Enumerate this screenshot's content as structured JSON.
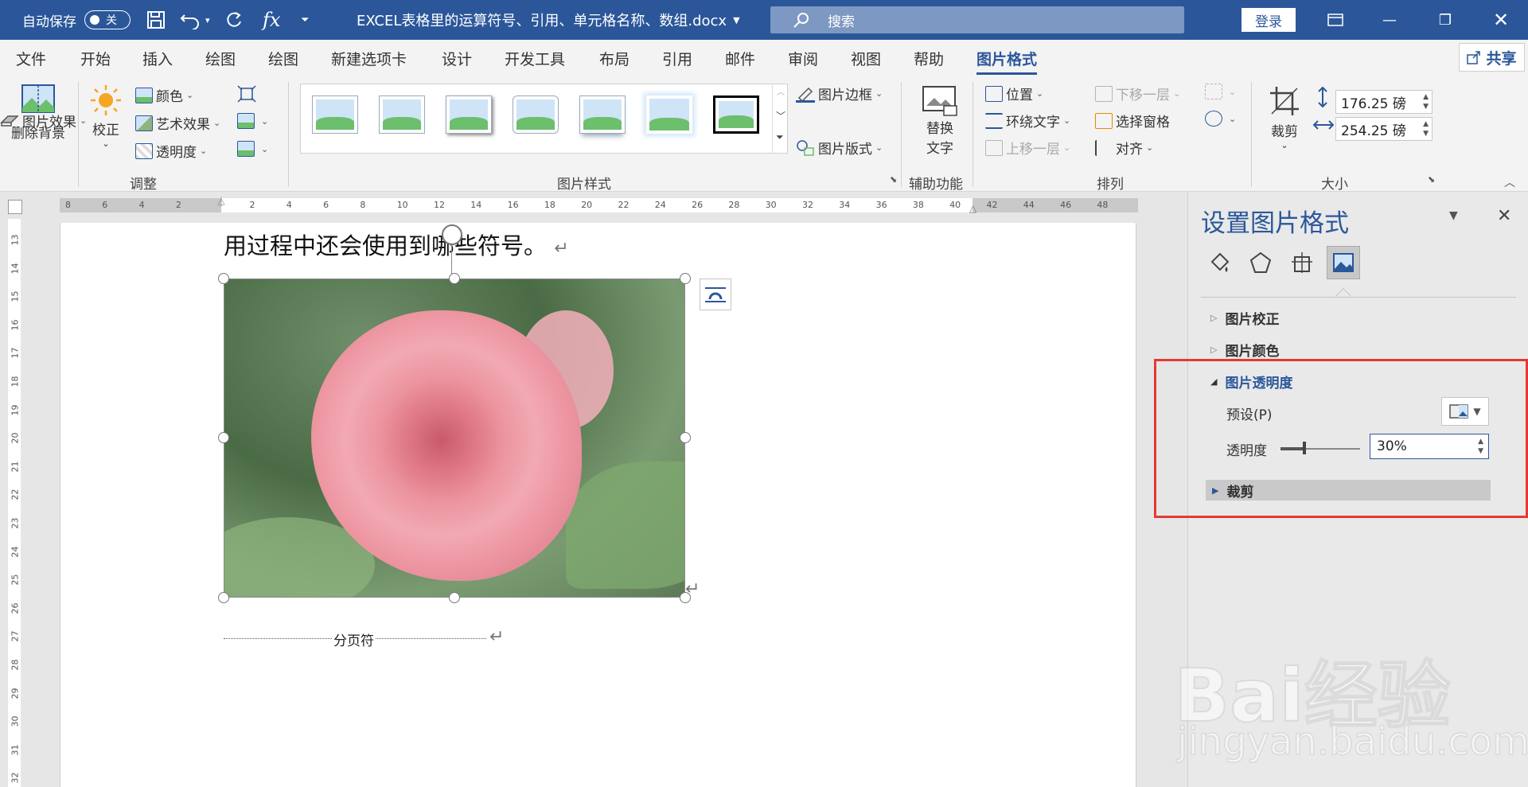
{
  "titlebar": {
    "autosave_label": "自动保存",
    "autosave_state": "关",
    "doc_title": "EXCEL表格里的运算符号、引用、单元格名称、数组.docx",
    "search_placeholder": "搜索",
    "login_label": "登录",
    "fx_label": "fx"
  },
  "menu": {
    "tabs": [
      "文件",
      "开始",
      "插入",
      "绘图",
      "绘图",
      "新建选项卡",
      "设计",
      "开发工具",
      "布局",
      "引用",
      "邮件",
      "审阅",
      "视图",
      "帮助",
      "图片格式"
    ],
    "share_label": "共享"
  },
  "ribbon": {
    "remove_bg": "删除背景",
    "correct": "校正",
    "color": "颜色",
    "art_effect": "艺术效果",
    "transparency": "透明度",
    "group_adjust": "调整",
    "group_pic_style": "图片样式",
    "pic_border": "图片边框",
    "pic_effect": "图片效果",
    "pic_layout": "图片版式",
    "alt_text_1": "替换",
    "alt_text_2": "文字",
    "group_access": "辅助功能",
    "position": "位置",
    "wrap_text": "环绕文字",
    "bring_forward": "上移一层",
    "send_backward": "下移一层",
    "selection_pane": "选择窗格",
    "align": "对齐",
    "group_arrange": "排列",
    "crop": "裁剪",
    "height_value": "176.25 磅",
    "width_value": "254.25 磅",
    "group_size": "大小"
  },
  "ruler": {
    "h_labels": [
      "8",
      "6",
      "4",
      "2",
      "",
      "2",
      "4",
      "6",
      "8",
      "10",
      "12",
      "14",
      "16",
      "18",
      "20",
      "22",
      "24",
      "26",
      "28",
      "30",
      "32",
      "34",
      "36",
      "38",
      "40",
      "42",
      "44",
      "46",
      "48"
    ],
    "v_labels": [
      "13",
      "14",
      "15",
      "16",
      "17",
      "18",
      "19",
      "20",
      "21",
      "22",
      "23",
      "24",
      "25",
      "26",
      "27",
      "28",
      "29",
      "30",
      "31",
      "32"
    ]
  },
  "document": {
    "text_line": "用过程中还会使用到哪些符号。",
    "page_break_label": "分页符"
  },
  "pane": {
    "title": "设置图片格式",
    "sections": {
      "correction": "图片校正",
      "color": "图片颜色",
      "transparency": "图片透明度",
      "crop": "裁剪"
    },
    "preset_label": "预设(P)",
    "transparency_label": "透明度",
    "transparency_value": "30%",
    "transparency_level": 0.3
  },
  "watermark": {
    "logo": "Bai经验",
    "url": "jingyan.baidu.com"
  },
  "colors": {
    "accent": "#2b579a",
    "highlight_box": "#e53935"
  }
}
